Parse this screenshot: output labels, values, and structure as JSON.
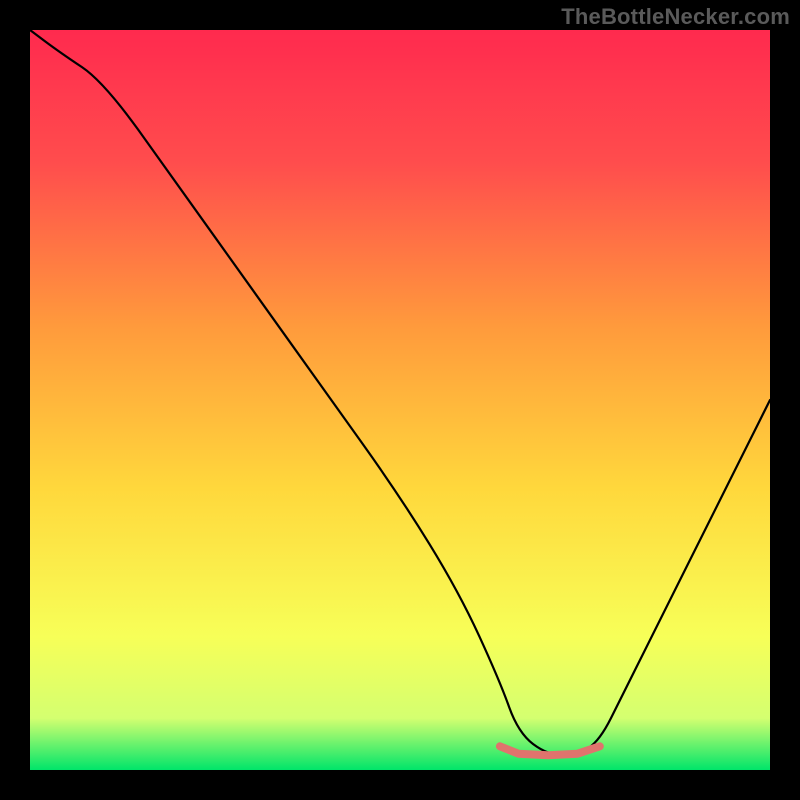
{
  "watermark": "TheBottleNecker.com",
  "chart_data": {
    "type": "line",
    "title": "",
    "xlabel": "",
    "ylabel": "",
    "xlim": [
      0,
      100
    ],
    "ylim": [
      0,
      100
    ],
    "grid": false,
    "background_gradient": {
      "stops": [
        {
          "pct": 0,
          "color": "#ff2a4e"
        },
        {
          "pct": 18,
          "color": "#ff4d4d"
        },
        {
          "pct": 40,
          "color": "#ff9a3c"
        },
        {
          "pct": 62,
          "color": "#ffd83c"
        },
        {
          "pct": 82,
          "color": "#f7ff58"
        },
        {
          "pct": 93,
          "color": "#d4ff70"
        },
        {
          "pct": 100,
          "color": "#00e56a"
        }
      ]
    },
    "series": [
      {
        "name": "bottleneck-curve",
        "color": "#000000",
        "width": 2.2,
        "x": [
          0,
          4,
          10,
          20,
          30,
          40,
          50,
          58,
          63.5,
          66,
          70,
          74,
          77,
          80,
          86,
          92,
          97,
          100
        ],
        "y": [
          100,
          97,
          93,
          79,
          65,
          51,
          37,
          24,
          12,
          5,
          2,
          2,
          4,
          10,
          22,
          34,
          44,
          50
        ]
      }
    ],
    "trough_segment": {
      "name": "optimal-zone",
      "color": "#e0736d",
      "width": 8,
      "round_cap": true,
      "x": [
        63.5,
        66,
        70,
        74,
        77
      ],
      "y": [
        3.2,
        2.2,
        2,
        2.2,
        3.2
      ]
    }
  }
}
